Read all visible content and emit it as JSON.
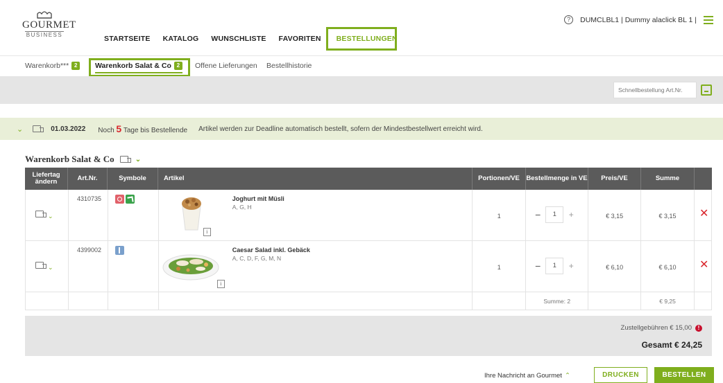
{
  "logo": {
    "main": "GOURMET",
    "sub": "BUSINESS"
  },
  "nav": {
    "items": [
      {
        "label": "STARTSEITE"
      },
      {
        "label": "KATALOG"
      },
      {
        "label": "WUNSCHLISTE"
      },
      {
        "label": "FAVORITEN"
      },
      {
        "label": "BESTELLUNGEN"
      }
    ],
    "active_index": 4
  },
  "user": {
    "help": "?",
    "name": "DUMCLBL1 | Dummy alaclick BL 1 |"
  },
  "subtabs": {
    "items": [
      {
        "label": "Warenkorb***",
        "badge": "2"
      },
      {
        "label": "Warenkorb Salat & Co",
        "badge": "2"
      },
      {
        "label": "Offene Lieferungen"
      },
      {
        "label": "Bestellhistorie"
      }
    ]
  },
  "quick_order": {
    "placeholder": "Schnellbestellung Art.Nr."
  },
  "delivery": {
    "date": "01.03.2022",
    "prefix": "Noch",
    "days": "5",
    "suffix": "Tage bis Bestellende",
    "info": "Artikel werden zur Deadline automatisch bestellt, sofern der Mindestbestellwert erreicht wird."
  },
  "cart": {
    "title": "Warenkorb Salat & Co"
  },
  "table": {
    "headers": {
      "liefertag": "Liefertag ändern",
      "artnr": "Art.Nr.",
      "symbole": "Symbole",
      "artikel": "Artikel",
      "portionen": "Portionen/VE",
      "menge": "Bestellmenge in VE",
      "preis": "Preis/VE",
      "summe": "Summe"
    },
    "rows": [
      {
        "artnr": "4310735",
        "name": "Joghurt mit Müsli",
        "allergens": "A, G, H",
        "portionen": "1",
        "qty": "1",
        "preis": "€ 3,15",
        "summe": "€ 3,15"
      },
      {
        "artnr": "4399002",
        "name": "Caesar Salad inkl. Gebäck",
        "allergens": "A, C, D, F, G, M, N",
        "portionen": "1",
        "qty": "1",
        "preis": "€ 6,10",
        "summe": "€ 6,10"
      }
    ],
    "sum_row": {
      "label": "Summe: 2",
      "total": "€ 9,25"
    }
  },
  "totals": {
    "fee": "Zustellgebühren € 15,00",
    "grand": "Gesamt € 24,25"
  },
  "actions": {
    "message": "Ihre Nachricht an Gourmet",
    "print": "DRUCKEN",
    "order": "BESTELLEN"
  },
  "colors": {
    "accent": "#7fae1d",
    "alert": "#d9262c",
    "header_bg": "#5b5b5b"
  }
}
